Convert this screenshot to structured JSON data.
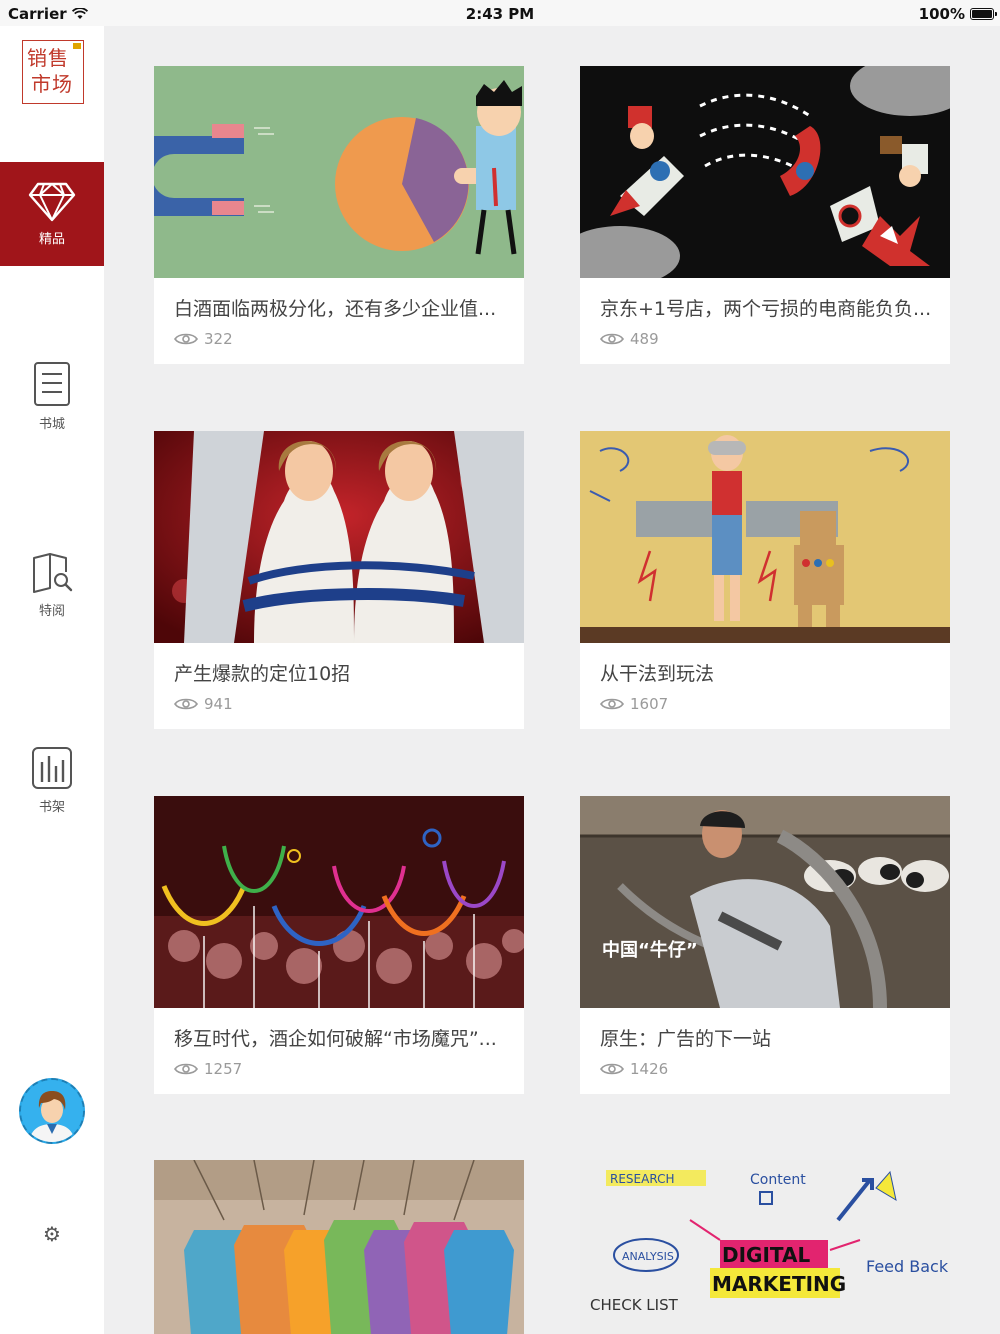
{
  "status": {
    "carrier": "Carrier",
    "time": "2:43 PM",
    "battery_text": "100%",
    "battery_level": 1.0
  },
  "sidebar": {
    "logo": {
      "line1": "销售",
      "line2": "市场"
    },
    "items": [
      {
        "label": "精品",
        "icon": "diamond-icon",
        "active": true
      },
      {
        "label": "书城",
        "icon": "document-icon",
        "active": false
      },
      {
        "label": "特阅",
        "icon": "book-search-icon",
        "active": false
      },
      {
        "label": "书架",
        "icon": "bookshelf-icon",
        "active": false
      }
    ],
    "avatar_icon": "user-avatar",
    "settings_icon": "gear-icon"
  },
  "articles": [
    {
      "title": "白酒面临两极分化，还有多少企业值...",
      "views": "322",
      "image": "magnet-and-pie-chart-illustration"
    },
    {
      "title": "京东+1号店，两个亏损的电商能负负...",
      "views": "489",
      "image": "rocket-crash-illustration"
    },
    {
      "title": "产生爆款的定位10招",
      "views": "941",
      "image": "beer-ad-photo"
    },
    {
      "title": "从干法到玩法",
      "views": "1607",
      "image": "child-cardboard-robot-photo"
    },
    {
      "title": "移互时代，酒企如何破解“市场魔咒”...",
      "views": "1257",
      "image": "neon-wine-glasses-illustration"
    },
    {
      "title": "原生：广告的下一站",
      "views": "1426",
      "image": "dairy-farm-worker-photo",
      "overlay": "中国“牛仔”"
    },
    {
      "title": "",
      "views": "",
      "image": "colorful-clothing-tags-illustration"
    },
    {
      "title": "",
      "views": "",
      "image": "digital-marketing-whiteboard",
      "words": [
        "DIGITAL",
        "MARKETING",
        "RESEARCH",
        "Content",
        "ANALYSIS",
        "Feed Back",
        "CHECK LIST"
      ]
    }
  ],
  "colors": {
    "accent": "#a0151a",
    "background": "#efeff0",
    "card": "#ffffff",
    "muted": "#9a9a9a"
  }
}
